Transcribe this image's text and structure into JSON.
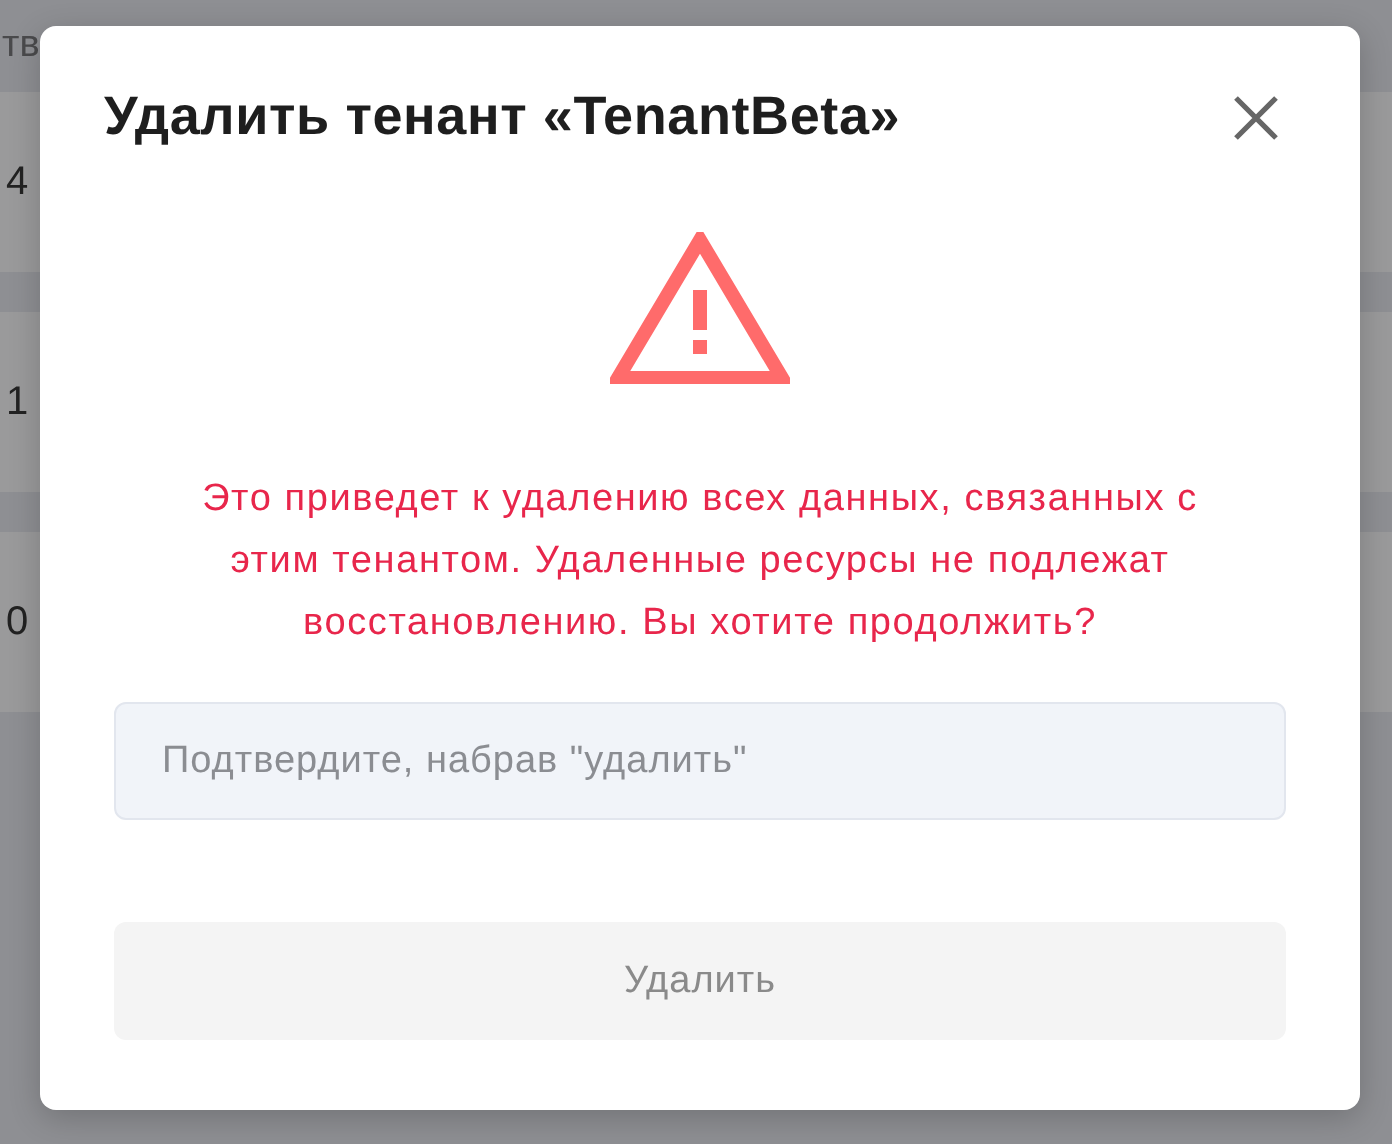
{
  "background_table": {
    "column_1": "тв",
    "rows": [
      {
        "column_1": "4"
      },
      {
        "column_1": "1"
      },
      {
        "column_1": "0"
      }
    ]
  },
  "dialog": {
    "title": "Удалить тенант «TenantBeta»",
    "warning": "Это приведет к удалению всех данных, связанных с этим тенантом. Удаленные ресурсы не подлежат восстановлению. Вы хотите продолжить?",
    "confirm_field": {
      "placeholder": "Подтвердите, набрав \"удалить\""
    },
    "delete_button": {
      "label": "Удалить",
      "disabled": true
    }
  }
}
